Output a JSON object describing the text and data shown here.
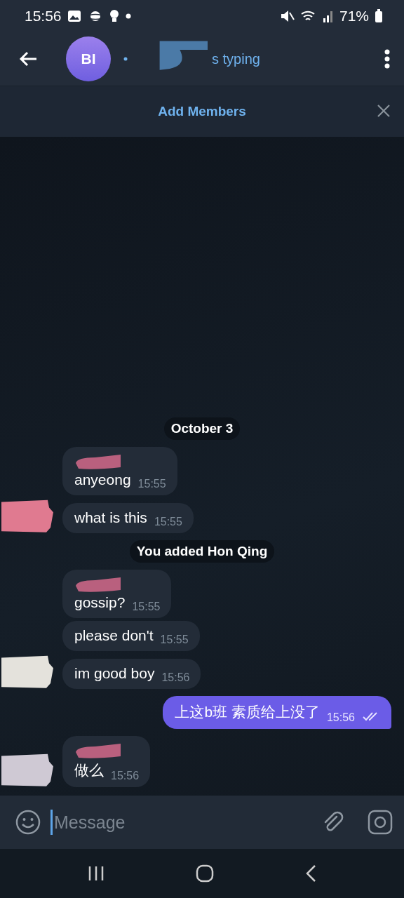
{
  "status_bar": {
    "time": "15:56",
    "battery": "71%"
  },
  "header": {
    "avatar_initials": "BI",
    "subtitle": "s typing"
  },
  "banner": {
    "label": "Add Members"
  },
  "messages": [
    {
      "kind": "date",
      "text": "October 3"
    },
    {
      "kind": "in",
      "text": "anyeong",
      "time": "15:55",
      "name_hidden": true
    },
    {
      "kind": "in",
      "text": "what is this",
      "time": "15:55",
      "name_hidden": false,
      "color": "#e07a90"
    },
    {
      "kind": "service",
      "text": "You added Hon Qing"
    },
    {
      "kind": "in",
      "text": "gossip?",
      "time": "15:55",
      "name_hidden": true
    },
    {
      "kind": "in",
      "text": "please don't",
      "time": "15:55",
      "name_hidden": false
    },
    {
      "kind": "in",
      "text": "im good boy",
      "time": "15:56",
      "name_hidden": false,
      "color": "#e4e2dc"
    },
    {
      "kind": "out",
      "text": "上这b班 素质给上没了",
      "time": "15:56",
      "read": true
    },
    {
      "kind": "in",
      "text": "做么",
      "time": "15:56",
      "name_hidden": true,
      "color": "#cfc9d4"
    }
  ],
  "composer": {
    "placeholder": "Message"
  }
}
